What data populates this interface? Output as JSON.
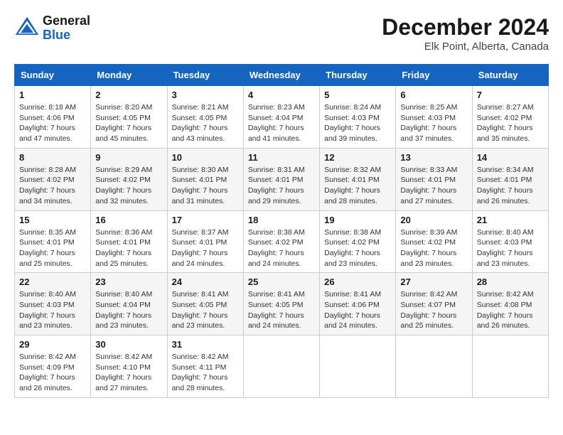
{
  "header": {
    "logo_line1": "General",
    "logo_line2": "Blue",
    "month_title": "December 2024",
    "location": "Elk Point, Alberta, Canada"
  },
  "weekdays": [
    "Sunday",
    "Monday",
    "Tuesday",
    "Wednesday",
    "Thursday",
    "Friday",
    "Saturday"
  ],
  "weeks": [
    [
      {
        "day": "1",
        "sunrise": "Sunrise: 8:18 AM",
        "sunset": "Sunset: 4:06 PM",
        "daylight": "Daylight: 7 hours and 47 minutes."
      },
      {
        "day": "2",
        "sunrise": "Sunrise: 8:20 AM",
        "sunset": "Sunset: 4:05 PM",
        "daylight": "Daylight: 7 hours and 45 minutes."
      },
      {
        "day": "3",
        "sunrise": "Sunrise: 8:21 AM",
        "sunset": "Sunset: 4:05 PM",
        "daylight": "Daylight: 7 hours and 43 minutes."
      },
      {
        "day": "4",
        "sunrise": "Sunrise: 8:23 AM",
        "sunset": "Sunset: 4:04 PM",
        "daylight": "Daylight: 7 hours and 41 minutes."
      },
      {
        "day": "5",
        "sunrise": "Sunrise: 8:24 AM",
        "sunset": "Sunset: 4:03 PM",
        "daylight": "Daylight: 7 hours and 39 minutes."
      },
      {
        "day": "6",
        "sunrise": "Sunrise: 8:25 AM",
        "sunset": "Sunset: 4:03 PM",
        "daylight": "Daylight: 7 hours and 37 minutes."
      },
      {
        "day": "7",
        "sunrise": "Sunrise: 8:27 AM",
        "sunset": "Sunset: 4:02 PM",
        "daylight": "Daylight: 7 hours and 35 minutes."
      }
    ],
    [
      {
        "day": "8",
        "sunrise": "Sunrise: 8:28 AM",
        "sunset": "Sunset: 4:02 PM",
        "daylight": "Daylight: 7 hours and 34 minutes."
      },
      {
        "day": "9",
        "sunrise": "Sunrise: 8:29 AM",
        "sunset": "Sunset: 4:02 PM",
        "daylight": "Daylight: 7 hours and 32 minutes."
      },
      {
        "day": "10",
        "sunrise": "Sunrise: 8:30 AM",
        "sunset": "Sunset: 4:01 PM",
        "daylight": "Daylight: 7 hours and 31 minutes."
      },
      {
        "day": "11",
        "sunrise": "Sunrise: 8:31 AM",
        "sunset": "Sunset: 4:01 PM",
        "daylight": "Daylight: 7 hours and 29 minutes."
      },
      {
        "day": "12",
        "sunrise": "Sunrise: 8:32 AM",
        "sunset": "Sunset: 4:01 PM",
        "daylight": "Daylight: 7 hours and 28 minutes."
      },
      {
        "day": "13",
        "sunrise": "Sunrise: 8:33 AM",
        "sunset": "Sunset: 4:01 PM",
        "daylight": "Daylight: 7 hours and 27 minutes."
      },
      {
        "day": "14",
        "sunrise": "Sunrise: 8:34 AM",
        "sunset": "Sunset: 4:01 PM",
        "daylight": "Daylight: 7 hours and 26 minutes."
      }
    ],
    [
      {
        "day": "15",
        "sunrise": "Sunrise: 8:35 AM",
        "sunset": "Sunset: 4:01 PM",
        "daylight": "Daylight: 7 hours and 25 minutes."
      },
      {
        "day": "16",
        "sunrise": "Sunrise: 8:36 AM",
        "sunset": "Sunset: 4:01 PM",
        "daylight": "Daylight: 7 hours and 25 minutes."
      },
      {
        "day": "17",
        "sunrise": "Sunrise: 8:37 AM",
        "sunset": "Sunset: 4:01 PM",
        "daylight": "Daylight: 7 hours and 24 minutes."
      },
      {
        "day": "18",
        "sunrise": "Sunrise: 8:38 AM",
        "sunset": "Sunset: 4:02 PM",
        "daylight": "Daylight: 7 hours and 24 minutes."
      },
      {
        "day": "19",
        "sunrise": "Sunrise: 8:38 AM",
        "sunset": "Sunset: 4:02 PM",
        "daylight": "Daylight: 7 hours and 23 minutes."
      },
      {
        "day": "20",
        "sunrise": "Sunrise: 8:39 AM",
        "sunset": "Sunset: 4:02 PM",
        "daylight": "Daylight: 7 hours and 23 minutes."
      },
      {
        "day": "21",
        "sunrise": "Sunrise: 8:40 AM",
        "sunset": "Sunset: 4:03 PM",
        "daylight": "Daylight: 7 hours and 23 minutes."
      }
    ],
    [
      {
        "day": "22",
        "sunrise": "Sunrise: 8:40 AM",
        "sunset": "Sunset: 4:03 PM",
        "daylight": "Daylight: 7 hours and 23 minutes."
      },
      {
        "day": "23",
        "sunrise": "Sunrise: 8:40 AM",
        "sunset": "Sunset: 4:04 PM",
        "daylight": "Daylight: 7 hours and 23 minutes."
      },
      {
        "day": "24",
        "sunrise": "Sunrise: 8:41 AM",
        "sunset": "Sunset: 4:05 PM",
        "daylight": "Daylight: 7 hours and 23 minutes."
      },
      {
        "day": "25",
        "sunrise": "Sunrise: 8:41 AM",
        "sunset": "Sunset: 4:05 PM",
        "daylight": "Daylight: 7 hours and 24 minutes."
      },
      {
        "day": "26",
        "sunrise": "Sunrise: 8:41 AM",
        "sunset": "Sunset: 4:06 PM",
        "daylight": "Daylight: 7 hours and 24 minutes."
      },
      {
        "day": "27",
        "sunrise": "Sunrise: 8:42 AM",
        "sunset": "Sunset: 4:07 PM",
        "daylight": "Daylight: 7 hours and 25 minutes."
      },
      {
        "day": "28",
        "sunrise": "Sunrise: 8:42 AM",
        "sunset": "Sunset: 4:08 PM",
        "daylight": "Daylight: 7 hours and 26 minutes."
      }
    ],
    [
      {
        "day": "29",
        "sunrise": "Sunrise: 8:42 AM",
        "sunset": "Sunset: 4:09 PM",
        "daylight": "Daylight: 7 hours and 26 minutes."
      },
      {
        "day": "30",
        "sunrise": "Sunrise: 8:42 AM",
        "sunset": "Sunset: 4:10 PM",
        "daylight": "Daylight: 7 hours and 27 minutes."
      },
      {
        "day": "31",
        "sunrise": "Sunrise: 8:42 AM",
        "sunset": "Sunset: 4:11 PM",
        "daylight": "Daylight: 7 hours and 28 minutes."
      },
      null,
      null,
      null,
      null
    ]
  ]
}
